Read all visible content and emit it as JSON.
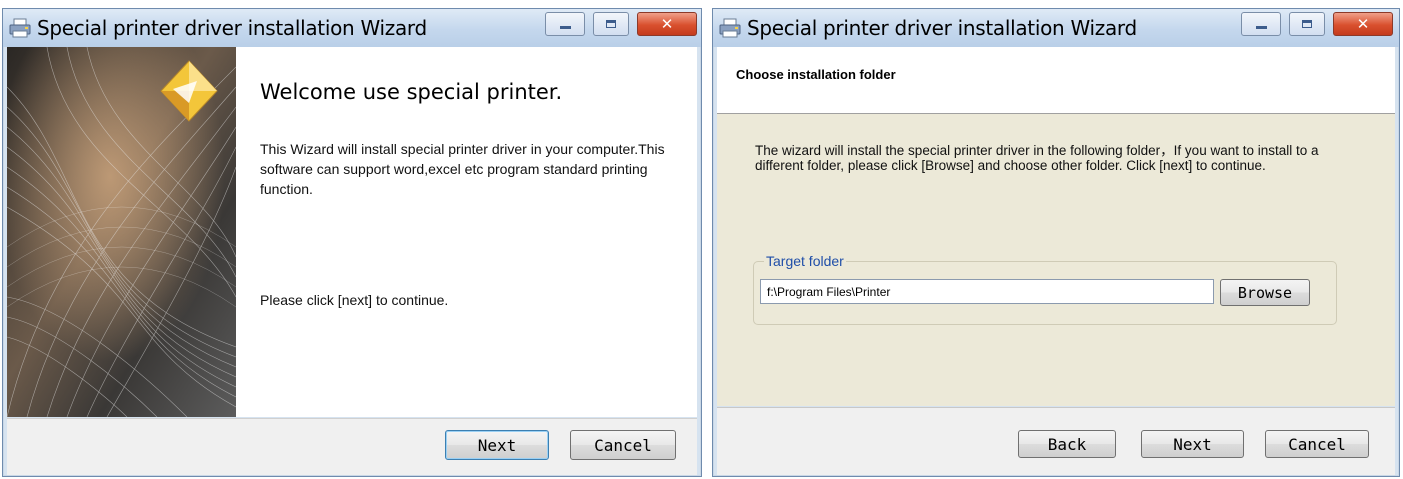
{
  "windows": [
    {
      "title": "Special printer driver installation Wizard",
      "heading": "Welcome use special printer.",
      "intro": "This Wizard will install special printer driver in your computer.This software can support word,excel etc program standard printing function.",
      "instruction": "Please click [next] to continue.",
      "buttons": {
        "next": "Next",
        "cancel": "Cancel"
      }
    },
    {
      "title": "Special printer driver installation Wizard",
      "heading": "Choose installation folder",
      "description": "The wizard will install the special printer driver in the following folder，If you want to install to a different folder, please click [Browse] and choose other folder. Click [next] to continue.",
      "target_folder": {
        "label": "Target folder",
        "value": "f:\\Program Files\\Printer",
        "browse_label": "Browse"
      },
      "buttons": {
        "back": "Back",
        "next": "Next",
        "cancel": "Cancel"
      }
    }
  ],
  "icons": [
    "printer-icon",
    "minimize-icon",
    "maximize-icon",
    "close-icon",
    "wizard-logo-icon"
  ],
  "colors": {
    "close_button": "#c43b1d",
    "group_label": "#1f4ea8",
    "titlebar": "#c4d7ed"
  }
}
